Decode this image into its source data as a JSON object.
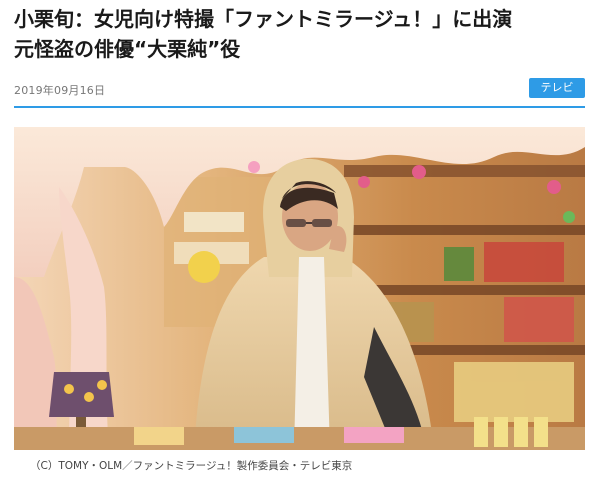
{
  "article": {
    "headline_line1": "小栗旬：女児向け特撮「ファントミラージュ！」に出演",
    "headline_line2": "元怪盗の俳優“大栗純”役",
    "date": "2019年09月16日",
    "category": "テレビ"
  },
  "photo": {
    "credit": "（C）TOMY・OLM／ファントミラージュ！製作委員会・テレビ東京"
  },
  "colors": {
    "accent": "#2e9be6"
  }
}
